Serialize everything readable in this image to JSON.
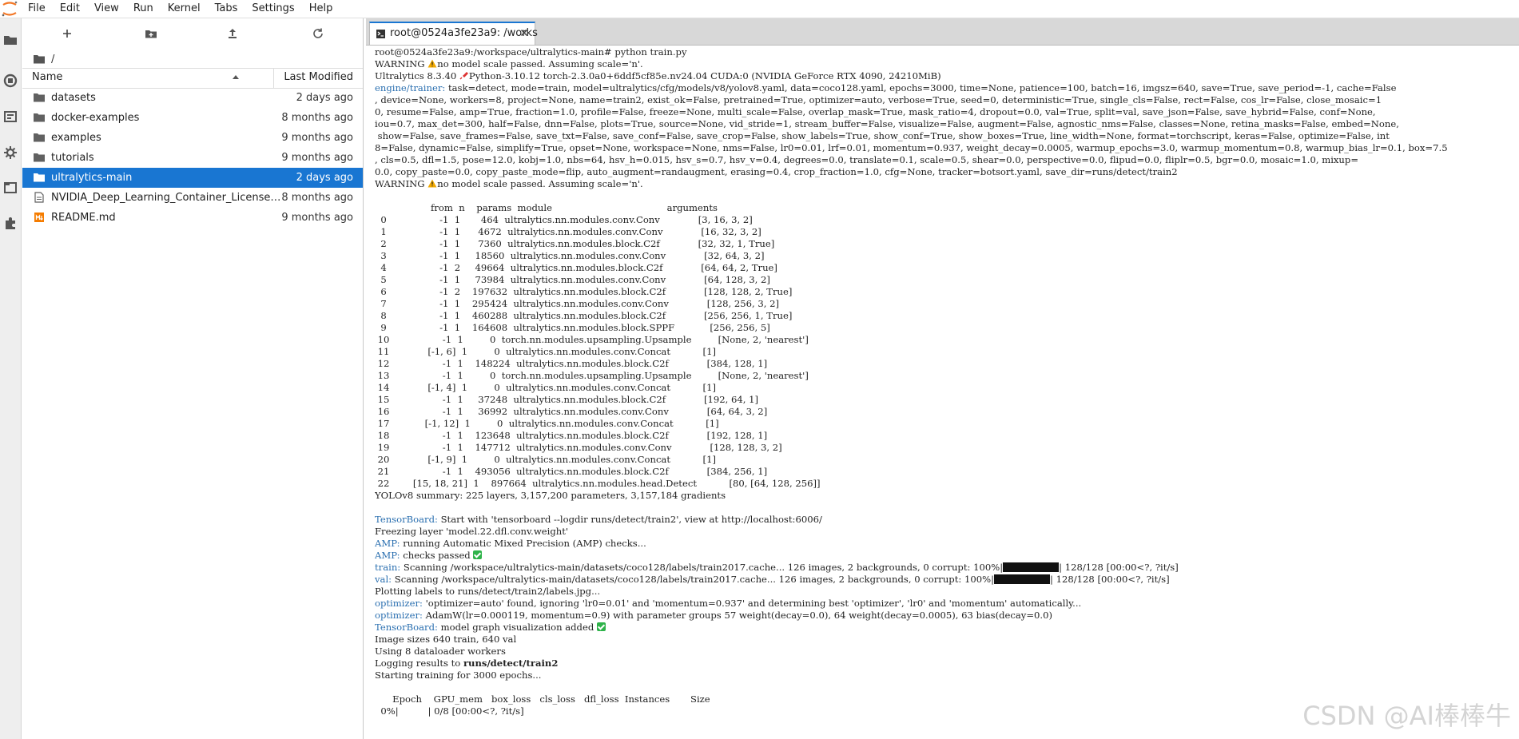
{
  "menubar": {
    "items": [
      "File",
      "Edit",
      "View",
      "Run",
      "Kernel",
      "Tabs",
      "Settings",
      "Help"
    ]
  },
  "file_browser": {
    "path": "/",
    "columns": {
      "name": "Name",
      "modified": "Last Modified"
    },
    "files": [
      {
        "name": "datasets",
        "modified": "2 days ago",
        "type": "folder",
        "selected": false
      },
      {
        "name": "docker-examples",
        "modified": "8 months ago",
        "type": "folder",
        "selected": false
      },
      {
        "name": "examples",
        "modified": "9 months ago",
        "type": "folder",
        "selected": false
      },
      {
        "name": "tutorials",
        "modified": "9 months ago",
        "type": "folder",
        "selected": false
      },
      {
        "name": "ultralytics-main",
        "modified": "2 days ago",
        "type": "folder",
        "selected": true
      },
      {
        "name": "NVIDIA_Deep_Learning_Container_License....",
        "modified": "8 months ago",
        "type": "file",
        "selected": false
      },
      {
        "name": "README.md",
        "modified": "9 months ago",
        "type": "markdown",
        "selected": false
      }
    ]
  },
  "tab": {
    "title": "root@0524a3fe23a9: /works"
  },
  "colors": {
    "accent": "#1976d2",
    "prefix": "#2a6fb0",
    "check": "#2fb34a",
    "warning": "#f0a800"
  },
  "terminal": {
    "prompt": "root@0524a3fe23a9:/workspace/ultralytics-main# python train.py",
    "warning1": "no model scale passed. Assuming scale='n'.",
    "warning_label": "WARNING",
    "ultra_version": "Ultralytics 8.3.40",
    "ultra_rest": "Python-3.10.12 torch-2.3.0a0+6ddf5cf85e.nv24.04 CUDA:0 (NVIDIA GeForce RTX 4090, 24210MiB)",
    "engine_prefix": "engine/trainer:",
    "engine_lines": [
      " task=detect, mode=train, model=ultralytics/cfg/models/v8/yolov8.yaml, data=coco128.yaml, epochs=3000, time=None, patience=100, batch=16, imgsz=640, save=True, save_period=-1, cache=False",
      ", device=None, workers=8, project=None, name=train2, exist_ok=False, pretrained=True, optimizer=auto, verbose=True, seed=0, deterministic=True, single_cls=False, rect=False, cos_lr=False, close_mosaic=1",
      "0, resume=False, amp=True, fraction=1.0, profile=False, freeze=None, multi_scale=False, overlap_mask=True, mask_ratio=4, dropout=0.0, val=True, split=val, save_json=False, save_hybrid=False, conf=None,",
      "iou=0.7, max_det=300, half=False, dnn=False, plots=True, source=None, vid_stride=1, stream_buffer=False, visualize=False, augment=False, agnostic_nms=False, classes=None, retina_masks=False, embed=None,",
      " show=False, save_frames=False, save_txt=False, save_conf=False, save_crop=False, show_labels=True, show_conf=True, show_boxes=True, line_width=None, format=torchscript, keras=False, optimize=False, int",
      "8=False, dynamic=False, simplify=True, opset=None, workspace=None, nms=False, lr0=0.01, lrf=0.01, momentum=0.937, weight_decay=0.0005, warmup_epochs=3.0, warmup_momentum=0.8, warmup_bias_lr=0.1, box=7.5",
      ", cls=0.5, dfl=1.5, pose=12.0, kobj=1.0, nbs=64, hsv_h=0.015, hsv_s=0.7, hsv_v=0.4, degrees=0.0, translate=0.1, scale=0.5, shear=0.0, perspective=0.0, flipud=0.0, fliplr=0.5, bgr=0.0, mosaic=1.0, mixup=",
      "0.0, copy_paste=0.0, copy_paste_mode=flip, auto_augment=randaugment, erasing=0.4, crop_fraction=1.0, cfg=None, tracker=botsort.yaml, save_dir=runs/detect/train2"
    ],
    "layer_header": "                   from  n    params  module                                       arguments                     ",
    "layers": [
      "  0                  -1  1       464  ultralytics.nn.modules.conv.Conv             [3, 16, 3, 2]                 ",
      "  1                  -1  1      4672  ultralytics.nn.modules.conv.Conv             [16, 32, 3, 2]                ",
      "  2                  -1  1      7360  ultralytics.nn.modules.block.C2f             [32, 32, 1, True]             ",
      "  3                  -1  1     18560  ultralytics.nn.modules.conv.Conv             [32, 64, 3, 2]                ",
      "  4                  -1  2     49664  ultralytics.nn.modules.block.C2f             [64, 64, 2, True]             ",
      "  5                  -1  1     73984  ultralytics.nn.modules.conv.Conv             [64, 128, 3, 2]               ",
      "  6                  -1  2    197632  ultralytics.nn.modules.block.C2f             [128, 128, 2, True]           ",
      "  7                  -1  1    295424  ultralytics.nn.modules.conv.Conv             [128, 256, 3, 2]              ",
      "  8                  -1  1    460288  ultralytics.nn.modules.block.C2f             [256, 256, 1, True]           ",
      "  9                  -1  1    164608  ultralytics.nn.modules.block.SPPF            [256, 256, 5]                 ",
      " 10                  -1  1         0  torch.nn.modules.upsampling.Upsample         [None, 2, 'nearest']          ",
      " 11             [-1, 6]  1         0  ultralytics.nn.modules.conv.Concat           [1]                           ",
      " 12                  -1  1    148224  ultralytics.nn.modules.block.C2f             [384, 128, 1]                 ",
      " 13                  -1  1         0  torch.nn.modules.upsampling.Upsample         [None, 2, 'nearest']          ",
      " 14             [-1, 4]  1         0  ultralytics.nn.modules.conv.Concat           [1]                           ",
      " 15                  -1  1     37248  ultralytics.nn.modules.block.C2f             [192, 64, 1]                  ",
      " 16                  -1  1     36992  ultralytics.nn.modules.conv.Conv             [64, 64, 3, 2]                ",
      " 17            [-1, 12]  1         0  ultralytics.nn.modules.conv.Concat           [1]                           ",
      " 18                  -1  1    123648  ultralytics.nn.modules.block.C2f             [192, 128, 1]                 ",
      " 19                  -1  1    147712  ultralytics.nn.modules.conv.Conv             [128, 128, 3, 2]              ",
      " 20             [-1, 9]  1         0  ultralytics.nn.modules.conv.Concat           [1]                           ",
      " 21                  -1  1    493056  ultralytics.nn.modules.block.C2f             [384, 256, 1]                 ",
      " 22        [15, 18, 21]  1    897664  ultralytics.nn.modules.head.Detect           [80, [64, 128, 256]]          "
    ],
    "summary": "YOLOv8 summary: 225 layers, 3,157,200 parameters, 3,157,184 gradients",
    "tb_prefix": "TensorBoard:",
    "tb_text": " Start with 'tensorboard --logdir runs/detect/train2', view at http://localhost:6006/",
    "freezing": "Freezing layer 'model.22.dfl.conv.weight'",
    "amp_prefix": "AMP:",
    "amp1": " running Automatic Mixed Precision (AMP) checks...",
    "amp2": " checks passed ",
    "train_prefix": "train:",
    "train_text": " Scanning /workspace/ultralytics-main/datasets/coco128/labels/train2017.cache... 126 images, 2 backgrounds, 0 corrupt: 100%|",
    "train_end": "| 128/128 [00:00<?, ?it/s]",
    "val_prefix": "val:",
    "val_text": " Scanning /workspace/ultralytics-main/datasets/coco128/labels/train2017.cache... 126 images, 2 backgrounds, 0 corrupt: 100%|",
    "val_end": "| 128/128 [00:00<?, ?it/s]",
    "scan_progress": 1.0,
    "plotting": "Plotting labels to runs/detect/train2/labels.jpg...",
    "opt_prefix": "optimizer:",
    "opt1": " 'optimizer=auto' found, ignoring 'lr0=0.01' and 'momentum=0.937' and determining best 'optimizer', 'lr0' and 'momentum' automatically...",
    "opt2": " AdamW(lr=0.000119, momentum=0.9) with parameter groups 57 weight(decay=0.0), 64 weight(decay=0.0005), 63 bias(decay=0.0)",
    "tb2": " model graph visualization added ",
    "img_sizes": "Image sizes 640 train, 640 val",
    "workers": "Using 8 dataloader workers",
    "logging_prefix": "Logging results to ",
    "logging_bold": "runs/detect/train2",
    "starting": "Starting training for 3000 epochs...",
    "epoch_header": "      Epoch    GPU_mem   box_loss   cls_loss   dfl_loss  Instances       Size",
    "epoch_progress": "  0%|          | 0/8 [00:00<?, ?it/s]"
  },
  "watermark": "CSDN @AI棒棒牛"
}
